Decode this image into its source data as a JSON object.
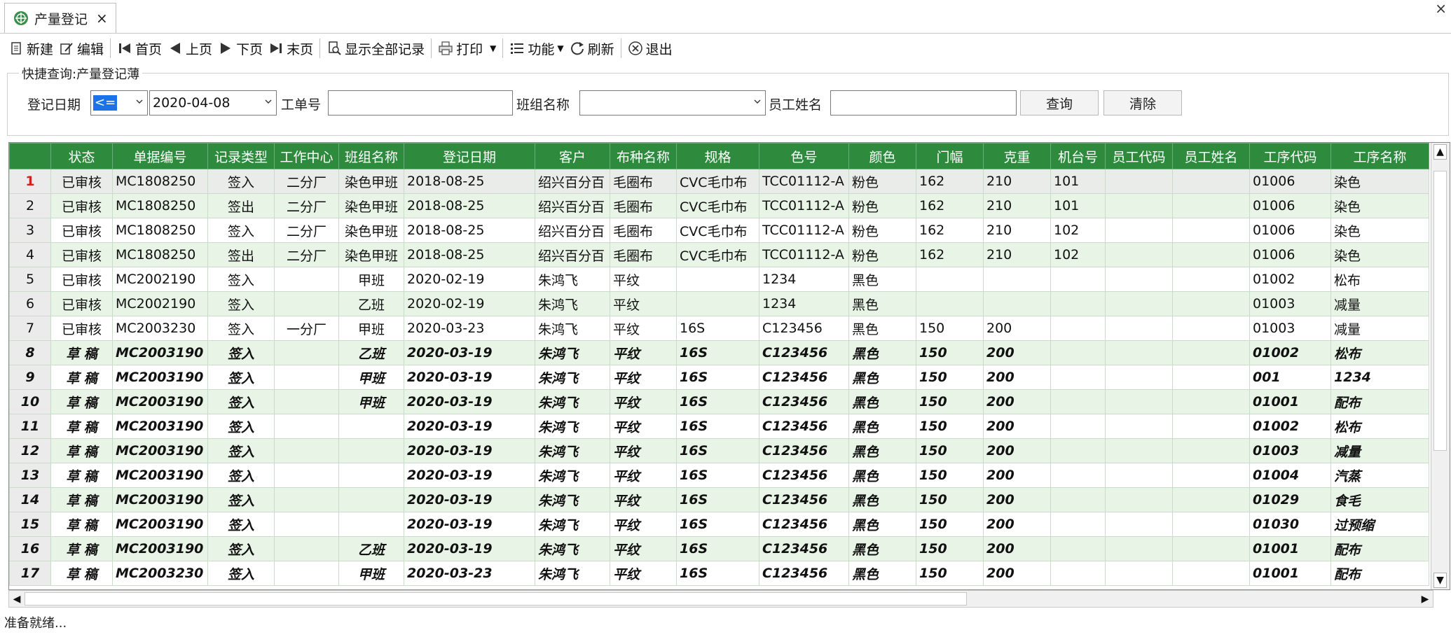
{
  "tab": {
    "title": "产量登记",
    "close": "×"
  },
  "window": {
    "close": "×"
  },
  "toolbar": {
    "new": "新建",
    "edit": "编辑",
    "first": "首页",
    "prev": "上页",
    "next": "下页",
    "last": "末页",
    "show_all": "显示全部记录",
    "print": "打印",
    "function": "功能",
    "refresh": "刷新",
    "exit": "退出"
  },
  "query": {
    "legend": "快捷查询:产量登记薄",
    "date_label": "登记日期",
    "operator": "<=",
    "date_value": "2020-04-08",
    "order_label": "工单号",
    "order_value": "",
    "team_label": "班组名称",
    "team_value": "",
    "employee_label": "员工姓名",
    "employee_value": "",
    "search_btn": "查询",
    "clear_btn": "清除"
  },
  "grid": {
    "columns": [
      "状态",
      "单据编号",
      "记录类型",
      "工作中心",
      "班组名称",
      "登记日期",
      "客户",
      "布种名称",
      "规格",
      "色号",
      "颜色",
      "门幅",
      "克重",
      "机台号",
      "员工代码",
      "员工姓名",
      "工序代码",
      "工序名称"
    ],
    "rows": [
      {
        "n": "1",
        "status": "已审核",
        "no": "MC1808250",
        "type": "签入",
        "center": "二分厂",
        "team": "染色甲班",
        "date": "2018-08-25",
        "customer": "绍兴百分百",
        "fabric": "毛圈布",
        "spec": "CVC毛巾布",
        "color_no": "TCC01112-A",
        "color": "粉色",
        "width": "162",
        "weight": "210",
        "machine": "101",
        "emp_code": "",
        "emp_name": "",
        "proc_code": "01006",
        "proc_name": "染色",
        "draft": false
      },
      {
        "n": "2",
        "status": "已审核",
        "no": "MC1808250",
        "type": "签出",
        "center": "二分厂",
        "team": "染色甲班",
        "date": "2018-08-25",
        "customer": "绍兴百分百",
        "fabric": "毛圈布",
        "spec": "CVC毛巾布",
        "color_no": "TCC01112-A",
        "color": "粉色",
        "width": "162",
        "weight": "210",
        "machine": "101",
        "emp_code": "",
        "emp_name": "",
        "proc_code": "01006",
        "proc_name": "染色",
        "draft": false
      },
      {
        "n": "3",
        "status": "已审核",
        "no": "MC1808250",
        "type": "签入",
        "center": "二分厂",
        "team": "染色甲班",
        "date": "2018-08-25",
        "customer": "绍兴百分百",
        "fabric": "毛圈布",
        "spec": "CVC毛巾布",
        "color_no": "TCC01112-A",
        "color": "粉色",
        "width": "162",
        "weight": "210",
        "machine": "102",
        "emp_code": "",
        "emp_name": "",
        "proc_code": "01006",
        "proc_name": "染色",
        "draft": false
      },
      {
        "n": "4",
        "status": "已审核",
        "no": "MC1808250",
        "type": "签出",
        "center": "二分厂",
        "team": "染色甲班",
        "date": "2018-08-25",
        "customer": "绍兴百分百",
        "fabric": "毛圈布",
        "spec": "CVC毛巾布",
        "color_no": "TCC01112-A",
        "color": "粉色",
        "width": "162",
        "weight": "210",
        "machine": "102",
        "emp_code": "",
        "emp_name": "",
        "proc_code": "01006",
        "proc_name": "染色",
        "draft": false
      },
      {
        "n": "5",
        "status": "已审核",
        "no": "MC2002190",
        "type": "签入",
        "center": "",
        "team": "甲班",
        "date": "2020-02-19",
        "customer": "朱鸿飞",
        "fabric": "平纹",
        "spec": "",
        "color_no": "1234",
        "color": "黑色",
        "width": "",
        "weight": "",
        "machine": "",
        "emp_code": "",
        "emp_name": "",
        "proc_code": "01002",
        "proc_name": "松布",
        "draft": false
      },
      {
        "n": "6",
        "status": "已审核",
        "no": "MC2002190",
        "type": "签入",
        "center": "",
        "team": "乙班",
        "date": "2020-02-19",
        "customer": "朱鸿飞",
        "fabric": "平纹",
        "spec": "",
        "color_no": "1234",
        "color": "黑色",
        "width": "",
        "weight": "",
        "machine": "",
        "emp_code": "",
        "emp_name": "",
        "proc_code": "01003",
        "proc_name": "减量",
        "draft": false
      },
      {
        "n": "7",
        "status": "已审核",
        "no": "MC2003230",
        "type": "签入",
        "center": "一分厂",
        "team": "甲班",
        "date": "2020-03-23",
        "customer": "朱鸿飞",
        "fabric": "平纹",
        "spec": "16S",
        "color_no": "C123456",
        "color": "黑色",
        "width": "150",
        "weight": "200",
        "machine": "",
        "emp_code": "",
        "emp_name": "",
        "proc_code": "01003",
        "proc_name": "减量",
        "draft": false
      },
      {
        "n": "8",
        "status": "草 稿",
        "no": "MC2003190",
        "type": "签入",
        "center": "",
        "team": "乙班",
        "date": "2020-03-19",
        "customer": "朱鸿飞",
        "fabric": "平纹",
        "spec": "16S",
        "color_no": "C123456",
        "color": "黑色",
        "width": "150",
        "weight": "200",
        "machine": "",
        "emp_code": "",
        "emp_name": "",
        "proc_code": "01002",
        "proc_name": "松布",
        "draft": true
      },
      {
        "n": "9",
        "status": "草 稿",
        "no": "MC2003190",
        "type": "签入",
        "center": "",
        "team": "甲班",
        "date": "2020-03-19",
        "customer": "朱鸿飞",
        "fabric": "平纹",
        "spec": "16S",
        "color_no": "C123456",
        "color": "黑色",
        "width": "150",
        "weight": "200",
        "machine": "",
        "emp_code": "",
        "emp_name": "",
        "proc_code": "001",
        "proc_name": "1234",
        "draft": true
      },
      {
        "n": "10",
        "status": "草 稿",
        "no": "MC2003190",
        "type": "签入",
        "center": "",
        "team": "甲班",
        "date": "2020-03-19",
        "customer": "朱鸿飞",
        "fabric": "平纹",
        "spec": "16S",
        "color_no": "C123456",
        "color": "黑色",
        "width": "150",
        "weight": "200",
        "machine": "",
        "emp_code": "",
        "emp_name": "",
        "proc_code": "01001",
        "proc_name": "配布",
        "draft": true
      },
      {
        "n": "11",
        "status": "草 稿",
        "no": "MC2003190",
        "type": "签入",
        "center": "",
        "team": "",
        "date": "2020-03-19",
        "customer": "朱鸿飞",
        "fabric": "平纹",
        "spec": "16S",
        "color_no": "C123456",
        "color": "黑色",
        "width": "150",
        "weight": "200",
        "machine": "",
        "emp_code": "",
        "emp_name": "",
        "proc_code": "01002",
        "proc_name": "松布",
        "draft": true
      },
      {
        "n": "12",
        "status": "草 稿",
        "no": "MC2003190",
        "type": "签入",
        "center": "",
        "team": "",
        "date": "2020-03-19",
        "customer": "朱鸿飞",
        "fabric": "平纹",
        "spec": "16S",
        "color_no": "C123456",
        "color": "黑色",
        "width": "150",
        "weight": "200",
        "machine": "",
        "emp_code": "",
        "emp_name": "",
        "proc_code": "01003",
        "proc_name": "减量",
        "draft": true
      },
      {
        "n": "13",
        "status": "草 稿",
        "no": "MC2003190",
        "type": "签入",
        "center": "",
        "team": "",
        "date": "2020-03-19",
        "customer": "朱鸿飞",
        "fabric": "平纹",
        "spec": "16S",
        "color_no": "C123456",
        "color": "黑色",
        "width": "150",
        "weight": "200",
        "machine": "",
        "emp_code": "",
        "emp_name": "",
        "proc_code": "01004",
        "proc_name": "汽蒸",
        "draft": true
      },
      {
        "n": "14",
        "status": "草 稿",
        "no": "MC2003190",
        "type": "签入",
        "center": "",
        "team": "",
        "date": "2020-03-19",
        "customer": "朱鸿飞",
        "fabric": "平纹",
        "spec": "16S",
        "color_no": "C123456",
        "color": "黑色",
        "width": "150",
        "weight": "200",
        "machine": "",
        "emp_code": "",
        "emp_name": "",
        "proc_code": "01029",
        "proc_name": "食毛",
        "draft": true
      },
      {
        "n": "15",
        "status": "草 稿",
        "no": "MC2003190",
        "type": "签入",
        "center": "",
        "team": "",
        "date": "2020-03-19",
        "customer": "朱鸿飞",
        "fabric": "平纹",
        "spec": "16S",
        "color_no": "C123456",
        "color": "黑色",
        "width": "150",
        "weight": "200",
        "machine": "",
        "emp_code": "",
        "emp_name": "",
        "proc_code": "01030",
        "proc_name": "过预缩",
        "draft": true
      },
      {
        "n": "16",
        "status": "草 稿",
        "no": "MC2003190",
        "type": "签入",
        "center": "",
        "team": "乙班",
        "date": "2020-03-19",
        "customer": "朱鸿飞",
        "fabric": "平纹",
        "spec": "16S",
        "color_no": "C123456",
        "color": "黑色",
        "width": "150",
        "weight": "200",
        "machine": "",
        "emp_code": "",
        "emp_name": "",
        "proc_code": "01001",
        "proc_name": "配布",
        "draft": true
      },
      {
        "n": "17",
        "status": "草 稿",
        "no": "MC2003230",
        "type": "签入",
        "center": "",
        "team": "甲班",
        "date": "2020-03-23",
        "customer": "朱鸿飞",
        "fabric": "平纹",
        "spec": "16S",
        "color_no": "C123456",
        "color": "黑色",
        "width": "150",
        "weight": "200",
        "machine": "",
        "emp_code": "",
        "emp_name": "",
        "proc_code": "01001",
        "proc_name": "配布",
        "draft": true
      }
    ]
  },
  "status_bar": {
    "text": "准备就绪..."
  },
  "colors": {
    "header_green": "#2e8b3d",
    "row_alt": "#e8f4e6",
    "accent_blue": "#1a73e8"
  }
}
